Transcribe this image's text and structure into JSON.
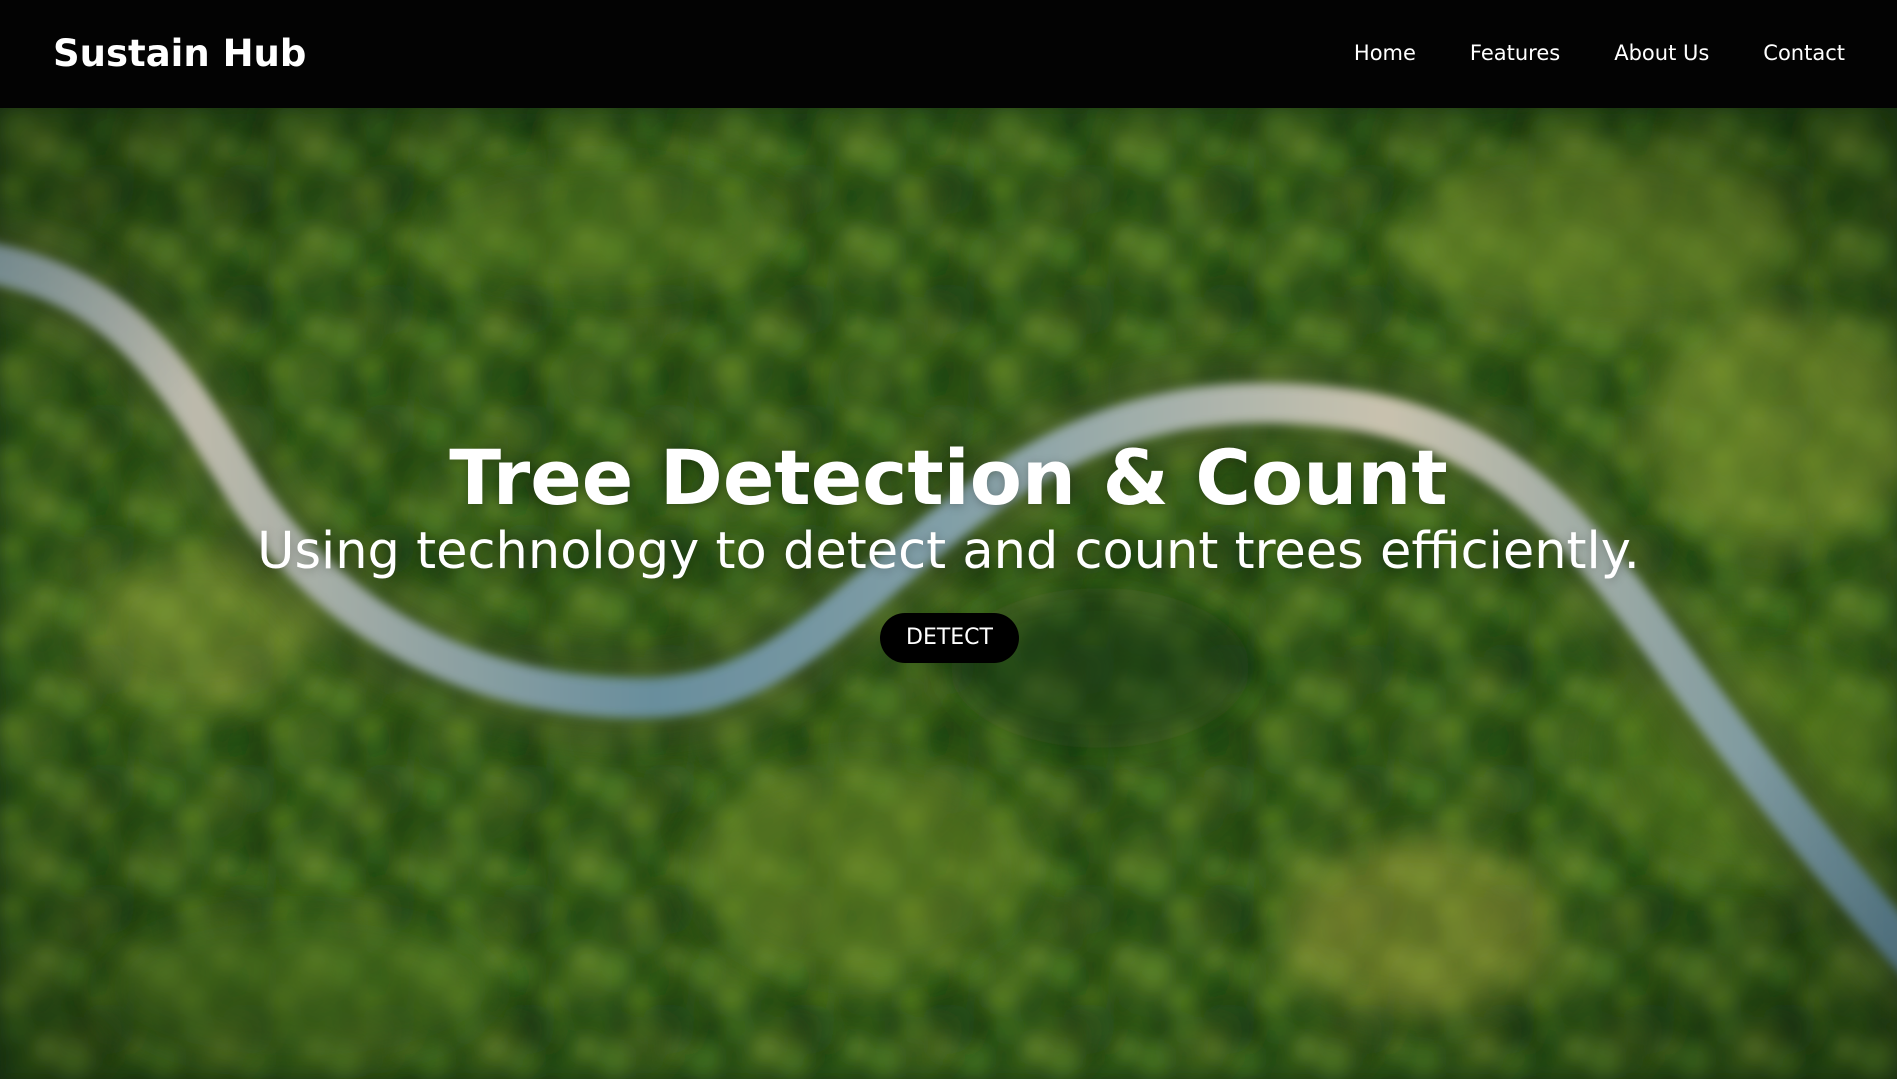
{
  "navbar": {
    "brand": "Sustain Hub",
    "links": [
      {
        "label": "Home"
      },
      {
        "label": "Features"
      },
      {
        "label": "About Us"
      },
      {
        "label": "Contact"
      }
    ]
  },
  "hero": {
    "title": "Tree Detection & Count",
    "subtitle": "Using technology to detect and count trees efficiently.",
    "button_label": "DETECT",
    "background": "aerial photo of a dense green forest with a winding road"
  },
  "colors": {
    "navbar_bg": "#030303",
    "text": "#ffffff",
    "button_bg": "#000000",
    "forest_dark": "#1c3a12",
    "forest_mid": "#3d6a1c",
    "forest_light": "#9aa83a",
    "road": "#7fa5b0"
  }
}
